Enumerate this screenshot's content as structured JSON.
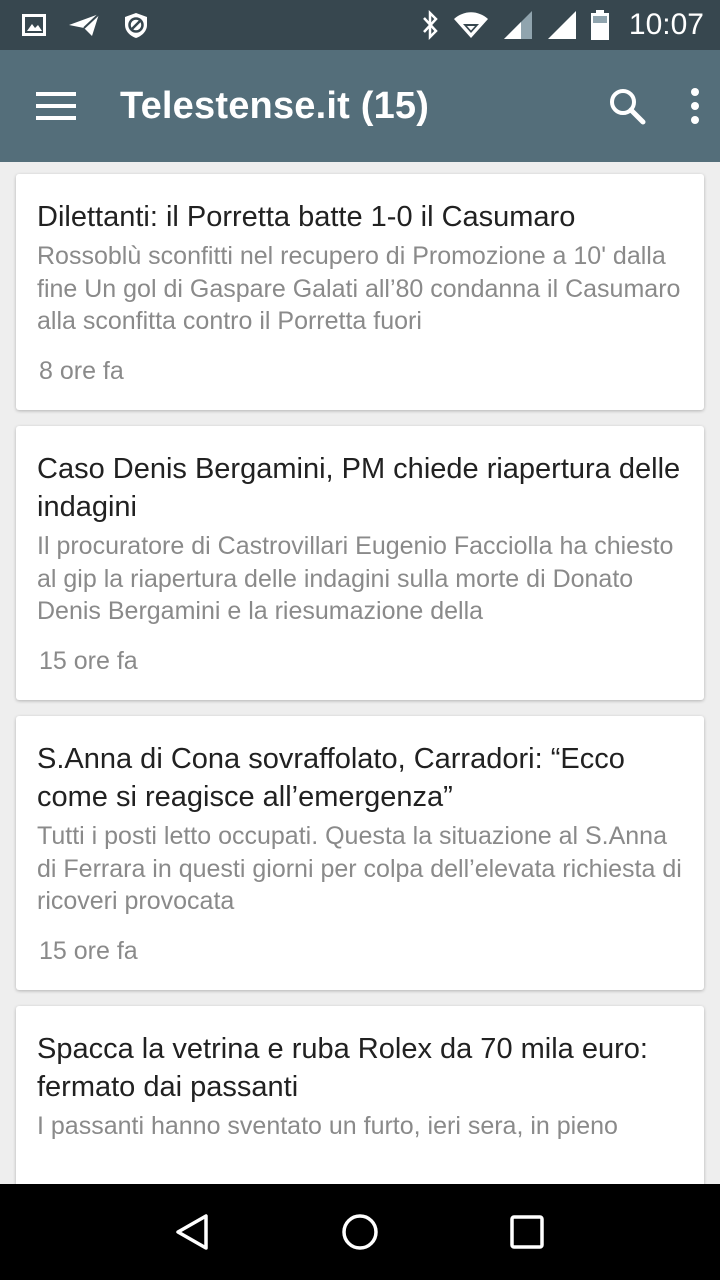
{
  "status_bar": {
    "time": "10:07",
    "icons_left": [
      "gallery-notification-icon",
      "send-notification-icon",
      "no-entry-notification-icon"
    ],
    "icons_right": [
      "bluetooth-icon",
      "wifi-icon",
      "cell-signal-icon",
      "cell-signal-icon",
      "battery-icon"
    ]
  },
  "app_bar": {
    "title": "Telestense.it (15)",
    "background": "#546e7a"
  },
  "articles": [
    {
      "title": "Dilettanti: il Porretta batte 1-0 il Casumaro",
      "summary": "Rossoblù sconfitti nel recupero di Promozione a 10' dalla fine Un gol di Gaspare Galati all’80 condanna il Casumaro alla sconfitta contro il Porretta fuori",
      "time": "8 ore fa"
    },
    {
      "title": "Caso Denis Bergamini, PM chiede riapertura delle indagini",
      "summary": "Il procuratore di Castrovillari Eugenio Facciolla ha chiesto al gip la riapertura delle indagini sulla morte di Donato Denis Bergamini e la riesumazione della",
      "time": "15 ore fa"
    },
    {
      "title": "S.Anna di Cona sovraffolato, Carradori: “Ecco come si reagisce all’emergenza”",
      "summary": "Tutti i posti letto occupati. Questa la situazione al S.Anna di Ferrara in questi giorni per colpa dell’elevata richiesta di ricoveri provocata",
      "time": "15 ore fa"
    },
    {
      "title": "Spacca la vetrina e ruba Rolex da 70 mila euro: fermato dai passanti",
      "summary": "I passanti hanno sventato un furto, ieri sera, in pieno",
      "time": ""
    }
  ]
}
